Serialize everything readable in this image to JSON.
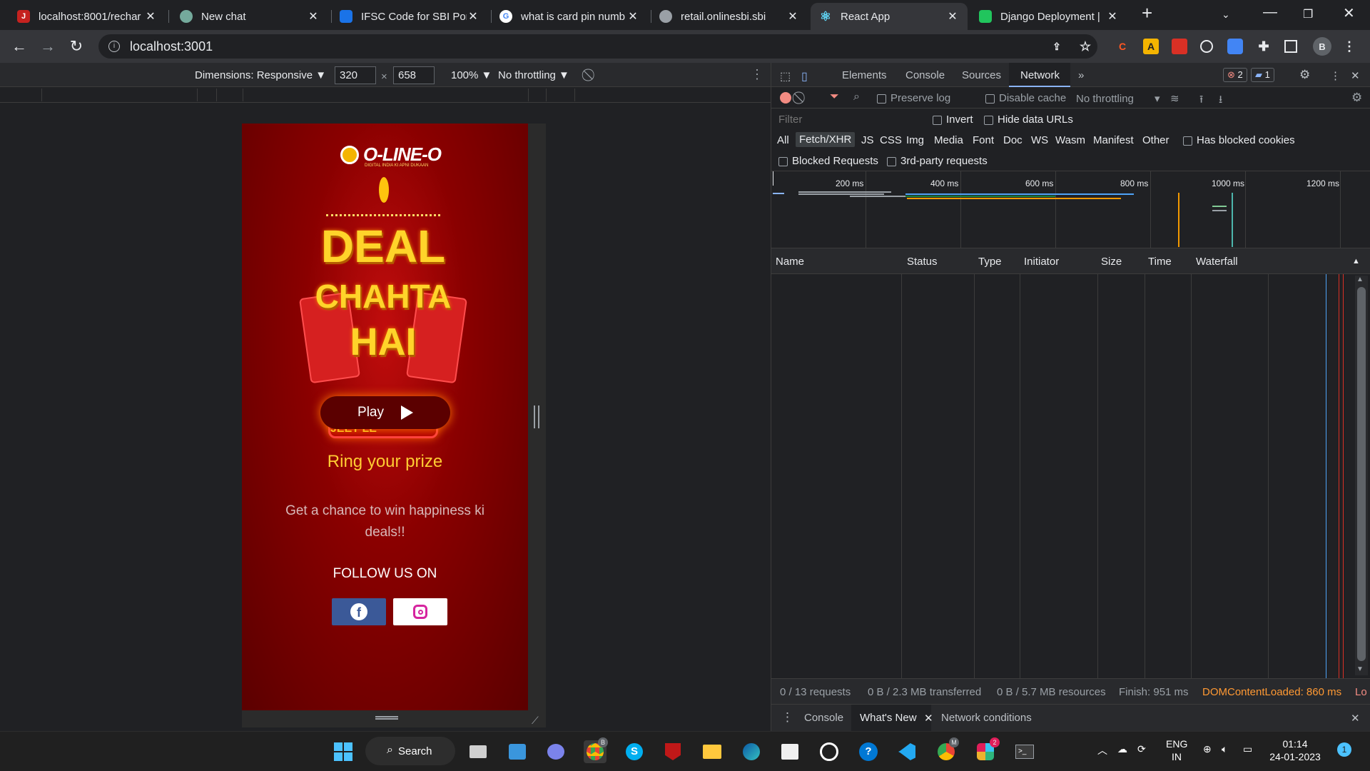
{
  "tabs": [
    {
      "title": "localhost:8001/rechar",
      "favicon": "J",
      "favicon_color": "#c5221f"
    },
    {
      "title": "New chat",
      "favicon": "",
      "favicon_color": "#74aa9c"
    },
    {
      "title": "IFSC Code for SBI Por",
      "favicon": "",
      "favicon_color": "#1a73e8"
    },
    {
      "title": "what is card pin numb",
      "favicon": "G",
      "favicon_color": "#ffffff"
    },
    {
      "title": "retail.onlinesbi.sbi",
      "favicon": "",
      "favicon_color": "#9aa0a6"
    },
    {
      "title": "React App",
      "favicon": "⚛",
      "favicon_color": "#61dafb"
    },
    {
      "title": "Django Deployment |",
      "favicon": "",
      "favicon_color": "#21c55d"
    }
  ],
  "address_bar": {
    "url": "localhost:3001"
  },
  "device_toolbar": {
    "dimensions_label": "Dimensions: Responsive ▼",
    "width": "320",
    "height": "658",
    "times": "×",
    "zoom": "100% ▼",
    "throttling": "No throttling ▼"
  },
  "page": {
    "logo_text": "O-LINE-O",
    "logo_tagline": "DIGITAL INDIA KI APNI DUKAAN",
    "banner_words": [
      "DEAL",
      "CHAHTA",
      "HAI"
    ],
    "offers_text": "OFFERS JO DIL JEET LE",
    "play_label": "Play",
    "prize_heading": "Ring your prize",
    "description": "Get a chance to win happiness ki deals!!",
    "follow_label": "FOLLOW US ON"
  },
  "devtools": {
    "tabs": [
      "Elements",
      "Console",
      "Sources",
      "Network"
    ],
    "active_tab": "Network",
    "more": "»",
    "errors_count": "2",
    "messages_count": "1",
    "preserve_log": "Preserve log",
    "disable_cache": "Disable cache",
    "throttling": "No throttling",
    "filter_placeholder": "Filter",
    "invert": "Invert",
    "hide_data_urls": "Hide data URLs",
    "filter_types": [
      "All",
      "Fetch/XHR",
      "JS",
      "CSS",
      "Img",
      "Media",
      "Font",
      "Doc",
      "WS",
      "Wasm",
      "Manifest",
      "Other"
    ],
    "active_filter": "Fetch/XHR",
    "has_blocked_cookies": "Has blocked cookies",
    "blocked_requests": "Blocked Requests",
    "third_party": "3rd-party requests",
    "overview_ticks": [
      "200 ms",
      "400 ms",
      "600 ms",
      "800 ms",
      "1000 ms",
      "1200 ms"
    ],
    "columns": [
      "Name",
      "Status",
      "Type",
      "Initiator",
      "Size",
      "Time",
      "Waterfall"
    ],
    "status": {
      "requests": "0 / 13 requests",
      "transferred": "0 B / 2.3 MB transferred",
      "resources": "0 B / 5.7 MB resources",
      "finish": "Finish: 951 ms",
      "dom_content_loaded": "DOMContentLoaded: 860 ms",
      "load": "Lo"
    },
    "drawer_tabs": [
      "Console",
      "What's New",
      "Network conditions"
    ],
    "active_drawer_tab": "What's New"
  },
  "taskbar": {
    "search_label": "Search",
    "lang_top": "ENG",
    "lang_bottom": "IN",
    "time": "01:14",
    "date": "24-01-2023",
    "notification_count": "1",
    "chrome_badge": "B",
    "chrome2_badge": "M",
    "slack_badge": "2"
  },
  "colors": {
    "accent_blue": "#8ab4f8",
    "dom_loaded": "#ff9933",
    "prize_yellow": "#ffcc33",
    "facebook": "#3b5998"
  }
}
